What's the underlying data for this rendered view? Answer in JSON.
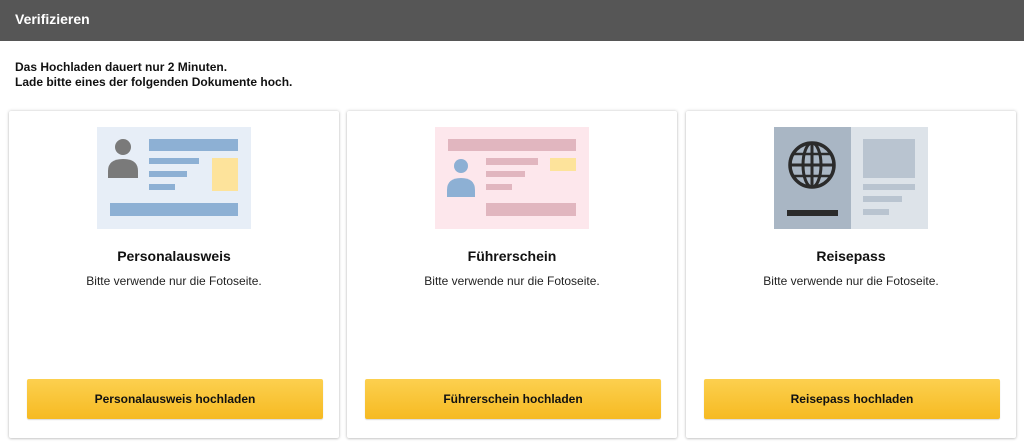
{
  "header": {
    "title": "Verifizieren"
  },
  "intro": {
    "line1": "Das Hochladen dauert nur 2 Minuten.",
    "line2": "Lade bitte eines der folgenden Dokumente hoch."
  },
  "cards": [
    {
      "title": "Personalausweis",
      "description": "Bitte verwende nur die Fotoseite.",
      "button": "Personalausweis hochladen",
      "icon": "id-card-icon"
    },
    {
      "title": "Führerschein",
      "description": "Bitte verwende nur die Fotoseite.",
      "button": "Führerschein hochladen",
      "icon": "drivers-license-icon"
    },
    {
      "title": "Reisepass",
      "description": "Bitte verwende nur die Fotoseite.",
      "button": "Reisepass hochladen",
      "icon": "passport-icon"
    }
  ],
  "colors": {
    "header_bg": "#565656",
    "button_top": "#fcd04f",
    "button_bottom": "#f6ba22"
  }
}
